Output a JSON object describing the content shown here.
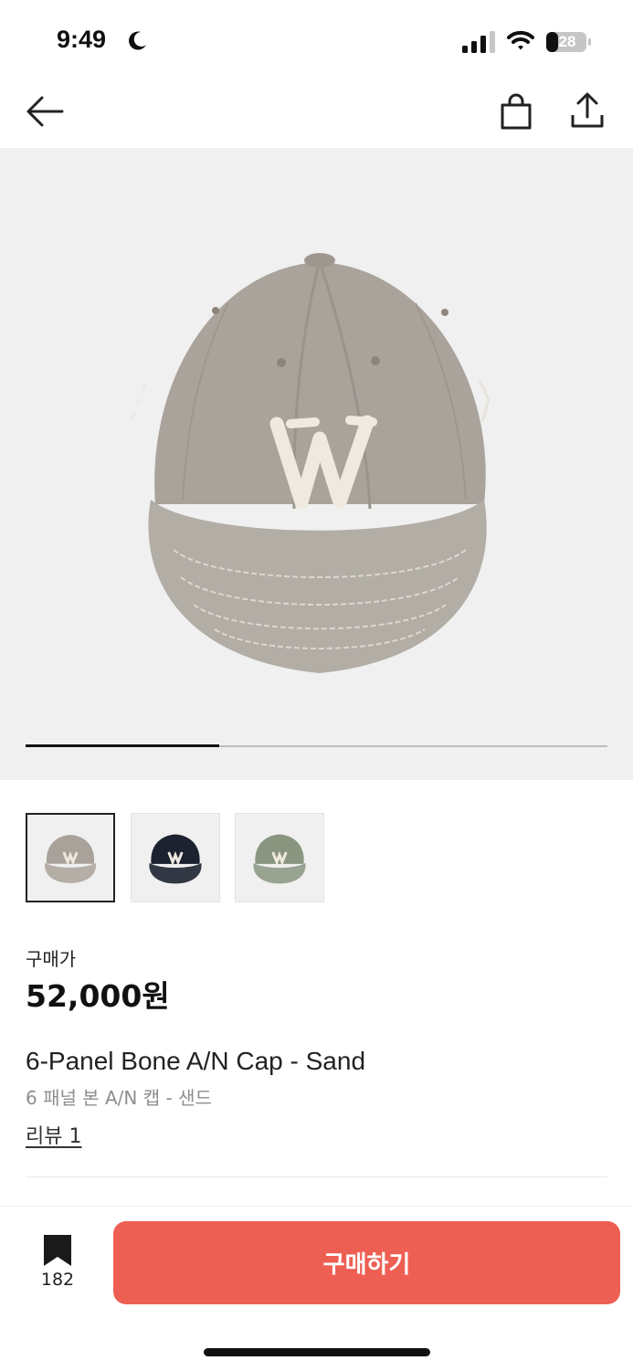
{
  "status_bar": {
    "time": "9:49",
    "battery": "28",
    "icons": [
      "moon-icon",
      "cellular-signal-icon",
      "wifi-icon",
      "battery-icon"
    ]
  },
  "nav": {
    "icons": [
      "back-arrow-icon",
      "shopping-bag-icon",
      "share-icon"
    ]
  },
  "gallery": {
    "image_count": 3,
    "current_index": 1,
    "thumbnails": [
      {
        "color": "Sand",
        "hex": "#a9a29a"
      },
      {
        "color": "Navy",
        "hex": "#1c2230"
      },
      {
        "color": "Olive",
        "hex": "#8a9580"
      }
    ]
  },
  "product": {
    "price_label": "구매가",
    "price": "52,000원",
    "name_en": "6-Panel Bone A/N Cap - Sand",
    "name_ko": "6 패널 본 A/N 캡 - 샌드",
    "review_link": "리뷰 1"
  },
  "bottom_bar": {
    "bookmark_count": "182",
    "buy_label": "구매하기"
  },
  "colors": {
    "accent": "#ee5f53",
    "hero_bg": "#f0f0f0"
  }
}
